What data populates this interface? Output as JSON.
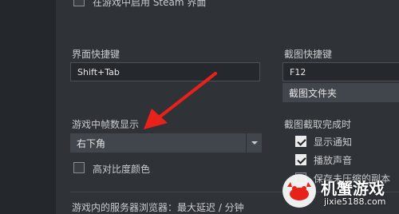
{
  "top": {
    "ingame_overlay_label": "在游戏中启用 Steam 界面"
  },
  "left": {
    "overlay_shortcut_label": "界面快捷键",
    "overlay_shortcut_value": "Shift+Tab",
    "fps_label": "游戏中帧数显示",
    "fps_value": "右下角",
    "high_contrast_label": "高对比度颜色",
    "server_browser_label": "游戏内的服务器浏览器：最大延迟 / 分钟"
  },
  "right": {
    "screenshot_shortcut_label": "截图快捷键",
    "screenshot_shortcut_value": "F12",
    "screenshot_folder_button": "截图文件夹",
    "screenshot_complete_label": "截图截取完成时",
    "notify_label": "显示通知",
    "play_sound_label": "播放声音",
    "save_uncompressed_label": "保存未压缩的副本"
  },
  "watermark": {
    "title": "机蟹游戏",
    "url": "jixie5188.com"
  }
}
